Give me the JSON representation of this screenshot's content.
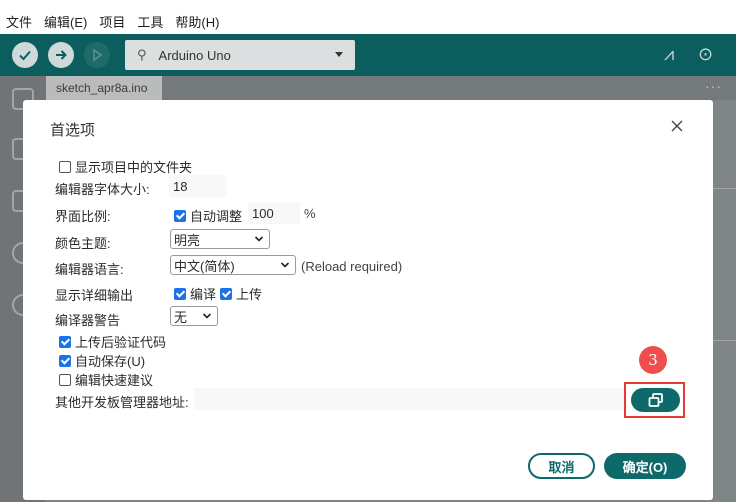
{
  "menubar": {
    "items": [
      "文件",
      "编辑(E)",
      "项目",
      "工具",
      "帮助(H)"
    ]
  },
  "toolbar": {
    "board_name": "Arduino Uno",
    "icons": [
      "verify-icon",
      "upload-icon",
      "debug-icon",
      "usb-icon",
      "serial-plotter-icon",
      "serial-monitor-icon"
    ]
  },
  "tabs": {
    "file_tab": "sketch_apr8a.ino",
    "more": "···"
  },
  "dialog": {
    "title": "首选项",
    "show_sketch_folder": {
      "label": "显示项目中的文件夹",
      "checked": false
    },
    "font_size": {
      "label": "编辑器字体大小:",
      "value": "18"
    },
    "interface_scale": {
      "label": "界面比例:",
      "auto_label": "自动调整",
      "auto_checked": true,
      "value": "100",
      "unit": "%"
    },
    "theme": {
      "label": "颜色主题:",
      "value": "明亮"
    },
    "language": {
      "label": "编辑器语言:",
      "value": "中文(简体)",
      "note": "(Reload required)"
    },
    "verbose": {
      "label": "显示详细输出",
      "compile_label": "编译",
      "compile_checked": true,
      "upload_label": "上传",
      "upload_checked": true
    },
    "warnings": {
      "label": "编译器警告",
      "value": "无"
    },
    "verify_after_upload": {
      "label": "上传后验证代码",
      "checked": true
    },
    "auto_save": {
      "label": "自动保存(U)",
      "checked": true
    },
    "quick_suggestions": {
      "label": "编辑快速建议",
      "checked": false
    },
    "board_manager_urls": {
      "label": "其他开发板管理器地址:",
      "value": ""
    },
    "step_badge": "3",
    "cancel_label": "取消",
    "ok_label": "确定(O)"
  },
  "colors": {
    "teal": "#0e6a6a",
    "highlight_red": "#e53935",
    "badge_red": "#ee4e4e",
    "checkbox_blue": "#1a73e8"
  }
}
